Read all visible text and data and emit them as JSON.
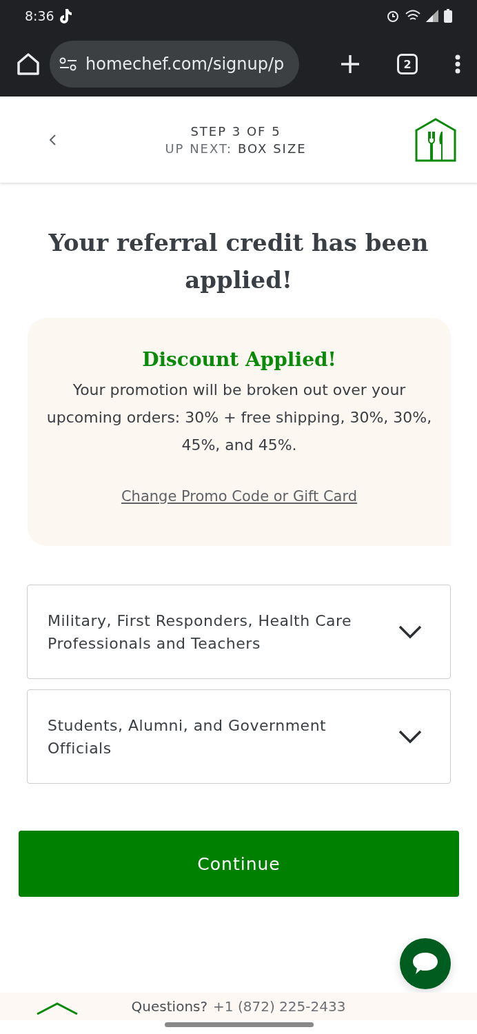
{
  "status_bar": {
    "time": "8:36"
  },
  "browser": {
    "url": "homechef.com/signup/p",
    "tab_count": "2"
  },
  "header": {
    "step": "STEP 3 OF 5",
    "next_label": "UP NEXT:",
    "next_value": "BOX SIZE"
  },
  "title": "Your referral credit has been applied!",
  "promo": {
    "heading": "Discount Applied!",
    "text": "Your promotion will be broken out over your upcoming orders: 30% + free shipping, 30%, 30%, 45%, and 45%.",
    "link": "Change Promo Code or Gift Card"
  },
  "accordions": [
    {
      "label": "Military, First Responders, Health Care Professionals and Teachers",
      "expanded": false
    },
    {
      "label": "Students, Alumni, and Government Officials",
      "expanded": false
    }
  ],
  "continue_button": "Continue",
  "footer": {
    "question": "Questions?",
    "phone": "+1 (872) 225-2433"
  }
}
